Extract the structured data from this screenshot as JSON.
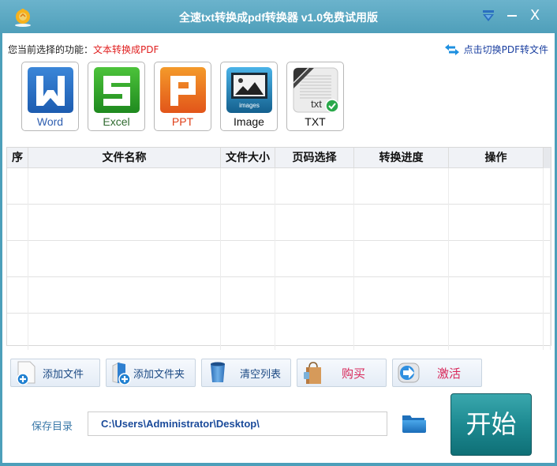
{
  "window": {
    "title": "全速txt转换成pdf转换器 v1.0免费试用版",
    "controls": {
      "menu_icon": "dropdown-menu-icon",
      "minimize": "—",
      "close": "X"
    }
  },
  "function_row": {
    "label": "您当前选择的功能：",
    "value": "文本转换成PDF",
    "switch_link": "点击切换PDF转文件"
  },
  "tiles": [
    {
      "label": "Word",
      "color": "#2f5fb0",
      "icon": "word-icon"
    },
    {
      "label": "Excel",
      "color": "#2f6a2f",
      "icon": "excel-icon"
    },
    {
      "label": "PPT",
      "color": "#e0401a",
      "icon": "ppt-icon"
    },
    {
      "label": "Image",
      "color": "#111111",
      "icon": "image-icon",
      "icon_text": "images"
    },
    {
      "label": "TXT",
      "color": "#111111",
      "icon": "txt-icon",
      "icon_text": "txt",
      "selected": true
    }
  ],
  "grid": {
    "columns": [
      "序",
      "文件名称",
      "文件大小",
      "页码选择",
      "转换进度",
      "操作"
    ],
    "rows": []
  },
  "actions": {
    "add_file": "添加文件",
    "add_folder": "添加文件夹",
    "clear_list": "清空列表",
    "buy": "购买",
    "activate": "激活"
  },
  "save": {
    "label": "保存目录",
    "path": "C:\\Users\\Administrator\\Desktop\\"
  },
  "start_button": "开始"
}
